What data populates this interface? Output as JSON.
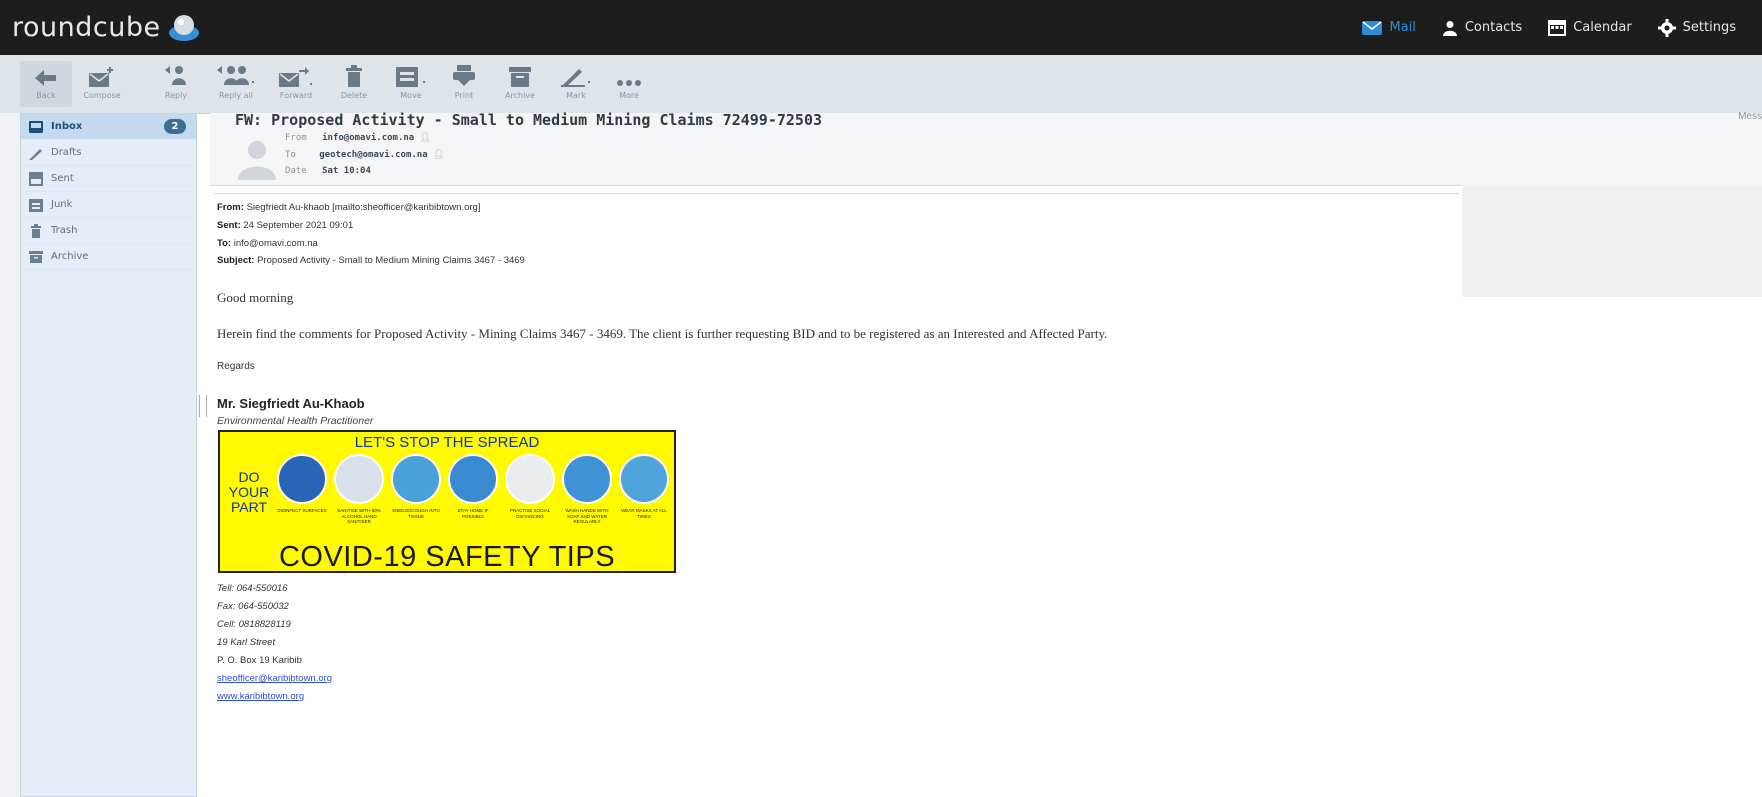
{
  "app": {
    "logo_text": "roundcube"
  },
  "topnav": [
    {
      "label": "Mail",
      "icon": "mail-icon",
      "active": true
    },
    {
      "label": "Contacts",
      "icon": "contacts-icon"
    },
    {
      "label": "Calendar",
      "icon": "calendar-icon"
    },
    {
      "label": "Settings",
      "icon": "gear-icon"
    }
  ],
  "toolbar": {
    "back": "Back",
    "compose": "Compose",
    "reply": "Reply",
    "reply_all": "Reply all",
    "forward": "Forward",
    "delete": "Delete",
    "move": "Move",
    "print": "Print",
    "archive": "Archive",
    "mark": "Mark",
    "more": "More"
  },
  "folders": [
    {
      "label": "Inbox",
      "icon": "inbox-icon",
      "count": "2",
      "selected": true
    },
    {
      "label": "Drafts",
      "icon": "pencil-icon"
    },
    {
      "label": "Sent",
      "icon": "sent-icon"
    },
    {
      "label": "Junk",
      "icon": "junk-icon"
    },
    {
      "label": "Trash",
      "icon": "trash-icon"
    },
    {
      "label": "Archive",
      "icon": "archive-icon"
    }
  ],
  "message": {
    "subject": "FW: Proposed Activity - Small to Medium Mining Claims 72499-72503",
    "from_label": "From",
    "from": "info@omavi.com.na",
    "to_label": "To",
    "to": "geotech@omavi.com.na",
    "date_label": "Date",
    "date": "Sat 10:04",
    "right_label": "Mess"
  },
  "body": {
    "fwd_from_label": "From:",
    "fwd_from": "Siegfriedt Au-khaob [mailto:sheofficer@karibibtown.org]",
    "fwd_sent_label": "Sent:",
    "fwd_sent": "24 September 2021 09:01",
    "fwd_to_label": "To:",
    "fwd_to": "info@omavi.com.na",
    "fwd_subject_label": "Subject:",
    "fwd_subject": "Proposed Activity - Small to Medium Mining Claims 3467 - 3469",
    "greeting": "Good morning",
    "paragraph": "Herein find the comments for Proposed Activity - Mining Claims  3467 - 3469.  The client is further requesting BID and to be registered as an Interested and Affected Party.",
    "regards": "Regards",
    "sig_name": "Mr. Siegfriedt Au-Khaob",
    "sig_role": "Environmental Health Practitioner",
    "tel": "Tell: 064-550016",
    "fax": "Fax: 064-550032",
    "cell": "Cell: 0818828119",
    "street": "19 Karl Street",
    "pobox": "P. O. Box 19 Karibib",
    "email_link": "sheofficer@karibibtown.org",
    "web_link": "www.karibibtown.org"
  },
  "banner": {
    "title": "LET'S STOP THE SPREAD",
    "do_your_part": [
      "DO",
      "YOUR",
      "PART"
    ],
    "main": "COVID-19 SAFETY TIPS",
    "tips": [
      {
        "caption": "DISINFECT SURFACES",
        "color": "#2a64b5"
      },
      {
        "caption": "SANITISE WITH 60% ALCOHOL HAND SANITISER",
        "color": "#d9e2ea"
      },
      {
        "caption": "SNEEZE/COUGH INTO TISSUE",
        "color": "#4aa0d8"
      },
      {
        "caption": "STAY HOME IF POSSIBLE",
        "color": "#3a8ad0"
      },
      {
        "caption": "PRACTISE SOCIAL DISTANCING",
        "color": "#e9edf0"
      },
      {
        "caption": "WASH HANDS WITH SOAP AND WATER REGULARLY",
        "color": "#3f93d5"
      },
      {
        "caption": "WEAR MASKS AT ALL TIMES",
        "color": "#4fa4dc"
      }
    ]
  },
  "colors": {
    "topbar": "#1d1d1d",
    "accent": "#2e8bd6",
    "sidebar": "#e5eef7",
    "banner": "#fffa00"
  }
}
